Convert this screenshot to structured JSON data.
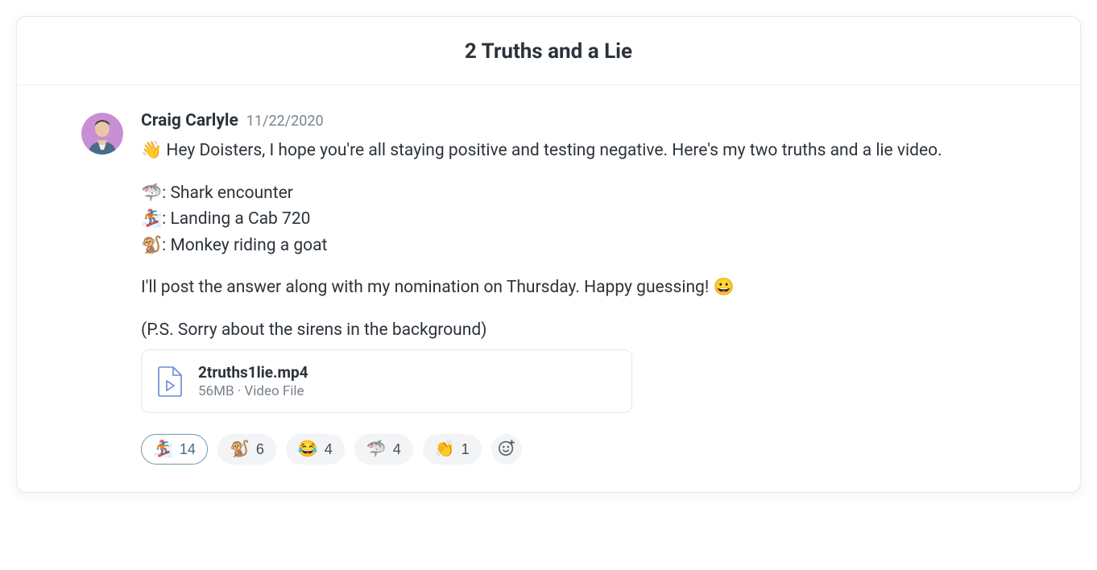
{
  "thread": {
    "title": "2 Truths and a Lie"
  },
  "message": {
    "author": "Craig Carlyle",
    "date": "11/22/2020",
    "intro_emoji": "👋",
    "intro_text": " Hey Doisters, I hope you're all staying positive and testing negative. Here's my two truths and a lie video.",
    "facts": [
      {
        "emoji": "🦈",
        "text": ": Shark encounter"
      },
      {
        "emoji": "🏂",
        "text": ": Landing a Cab 720"
      },
      {
        "emoji": "🐒",
        "text": ": Monkey riding a goat"
      }
    ],
    "outro_text_1": "I'll post the answer along with my nomination on Thursday. Happy guessing! ",
    "outro_emoji": "😀",
    "ps_text": "(P.S. Sorry about the sirens in the background)"
  },
  "attachment": {
    "filename": "2truths1lie.mp4",
    "size": "56MB",
    "separator": " · ",
    "type": "Video File"
  },
  "reactions": [
    {
      "emoji": "🏂",
      "count": "14",
      "selected": true
    },
    {
      "emoji": "🐒",
      "count": "6",
      "selected": false
    },
    {
      "emoji": "😂",
      "count": "4",
      "selected": false
    },
    {
      "emoji": "🦈",
      "count": "4",
      "selected": false
    },
    {
      "emoji": "👏",
      "count": "1",
      "selected": false
    }
  ]
}
